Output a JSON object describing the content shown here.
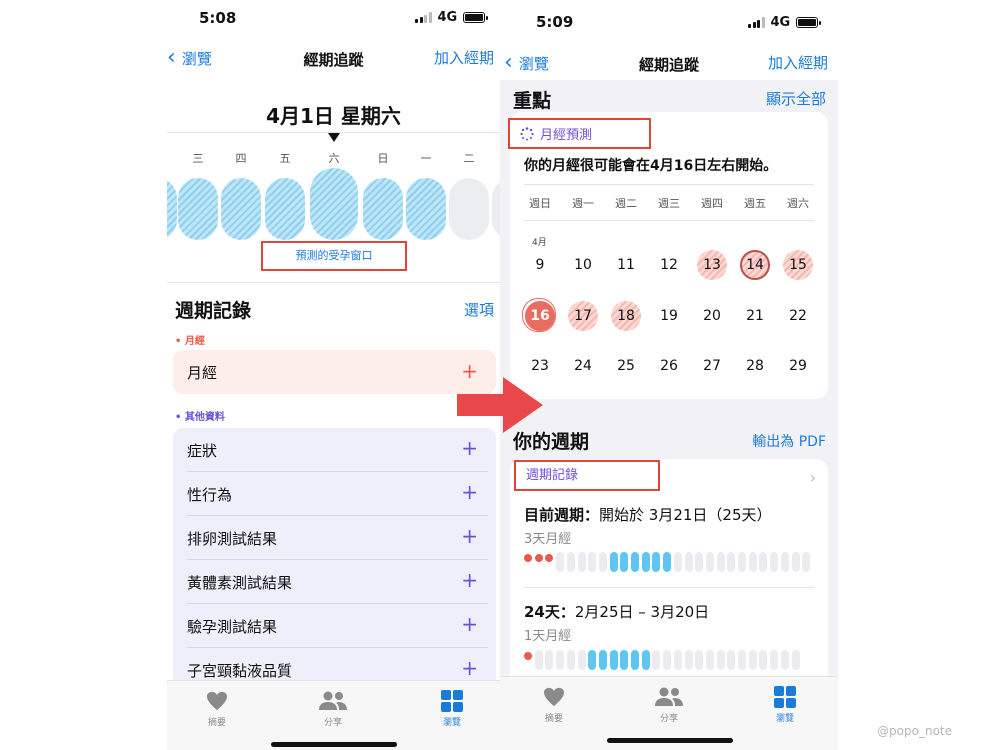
{
  "left": {
    "status": {
      "time": "5:08",
      "network": "4G"
    },
    "nav": {
      "back": "瀏覽",
      "title": "經期追蹤",
      "action": "加入經期"
    },
    "date_title": "4月1日 星期六",
    "weekdays": [
      "三",
      "四",
      "五",
      "六",
      "日",
      "一",
      "二"
    ],
    "fertile_label": "預測的受孕窗口",
    "cycle_log": {
      "title": "週期記錄",
      "options": "選項"
    },
    "period_category": "• 月經",
    "period_row": {
      "label": "月經",
      "plus": "+"
    },
    "other_category": "• 其他資料",
    "other_rows": [
      {
        "label": "症狀",
        "plus": "+"
      },
      {
        "label": "性行為",
        "plus": "+"
      },
      {
        "label": "排卵測試結果",
        "plus": "+"
      },
      {
        "label": "黃體素測試結果",
        "plus": "+"
      },
      {
        "label": "驗孕測試結果",
        "plus": "+"
      },
      {
        "label": "子宮頸黏液品質",
        "plus": "+"
      }
    ],
    "tabs": [
      {
        "label": "摘要",
        "icon": "heart-icon"
      },
      {
        "label": "分享",
        "icon": "people-icon"
      },
      {
        "label": "瀏覽",
        "icon": "grid-icon",
        "active": true
      }
    ]
  },
  "right": {
    "status": {
      "time": "5:09",
      "network": "4G"
    },
    "nav": {
      "back": "瀏覽",
      "title": "經期追蹤",
      "action": "加入經期"
    },
    "highlights": {
      "title": "重點",
      "show_all": "顯示全部"
    },
    "prediction": {
      "label": "月經預測",
      "text": "你的月經很可能會在4月16日左右開始。",
      "weekdays": [
        "週日",
        "週一",
        "週二",
        "週三",
        "週四",
        "週五",
        "週六"
      ],
      "month": "4月",
      "weeks": [
        [
          {
            "d": "9"
          },
          {
            "d": "10"
          },
          {
            "d": "11"
          },
          {
            "d": "12"
          },
          {
            "d": "13",
            "state": "pred"
          },
          {
            "d": "14",
            "state": "pred today"
          },
          {
            "d": "15",
            "state": "pred"
          }
        ],
        [
          {
            "d": "16",
            "state": "start"
          },
          {
            "d": "17",
            "state": "pred"
          },
          {
            "d": "18",
            "state": "pred"
          },
          {
            "d": "19"
          },
          {
            "d": "20"
          },
          {
            "d": "21"
          },
          {
            "d": "22"
          }
        ],
        [
          {
            "d": "23"
          },
          {
            "d": "24"
          },
          {
            "d": "25"
          },
          {
            "d": "26"
          },
          {
            "d": "27"
          },
          {
            "d": "28"
          },
          {
            "d": "29"
          }
        ]
      ]
    },
    "your_cycles": {
      "title": "你的週期",
      "export": "輸出為 PDF"
    },
    "cycle_log_label": "週期記錄",
    "cycles": [
      {
        "title": "目前週期：",
        "detail": "開始於 3月21日（25天）",
        "sub": "3天月經",
        "red_days": 3,
        "blue_start": 8,
        "blue_len": 6,
        "total": 25
      },
      {
        "title": "24天：",
        "detail": "2月25日 – 3月20日",
        "sub": "1天月經",
        "red_days": 1,
        "blue_start": 6,
        "blue_len": 6,
        "total": 24
      }
    ],
    "tabs": [
      {
        "label": "摘要",
        "icon": "heart-icon"
      },
      {
        "label": "分享",
        "icon": "people-icon"
      },
      {
        "label": "瀏覽",
        "icon": "grid-icon",
        "active": true
      }
    ]
  },
  "watermark": "@popo_note",
  "colors": {
    "accent_blue": "#1a7bd9",
    "period_red": "#ea5a4b",
    "fertile_blue": "#8dd0ef",
    "other_purple": "#6b4fd8",
    "annotation_red": "#e0453a"
  }
}
